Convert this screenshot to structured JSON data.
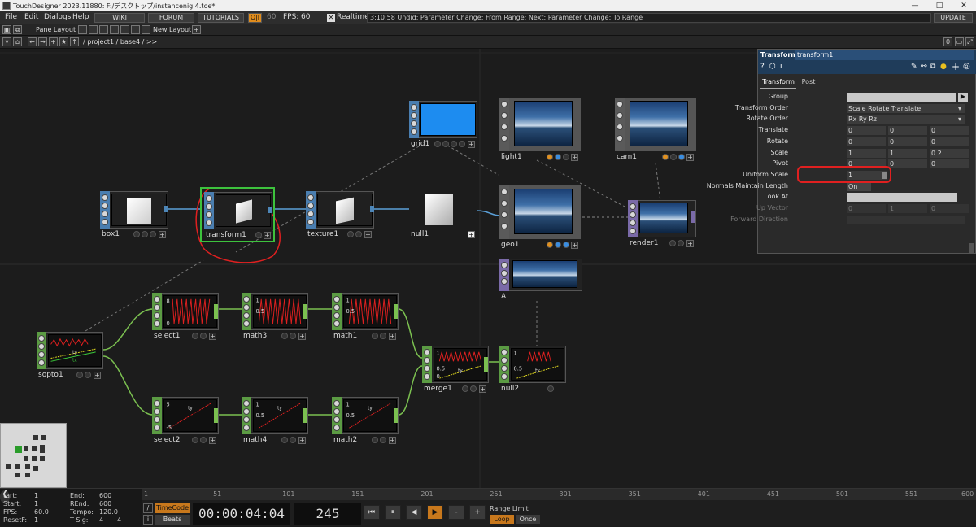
{
  "window": {
    "title": "TouchDesigner 2023.11880: F:/デスクトップ/instancenig.4.toe*",
    "minimize": "—",
    "maximize": "□",
    "close": "✕"
  },
  "menu": {
    "file": "File",
    "edit": "Edit",
    "dialogs": "Dialogs",
    "help": "Help",
    "wiki": "WIKI",
    "forum": "FORUM",
    "tutorials": "TUTORIALS",
    "oi": "O|I",
    "fps_small": "60",
    "fps_label": "FPS:",
    "fps_value": "60",
    "realtime_label": "Realtime",
    "status": "3:10:58 Undid: Parameter Change: From Range; Next: Parameter Change: To Range",
    "update": "UPDATE"
  },
  "toolbar": {
    "pane_layout": "Pane Layout",
    "new_layout": "New Layout"
  },
  "path": {
    "text": "/ project1 / base4 / >>",
    "count": "0"
  },
  "nodes": {
    "box1": "box1",
    "transform1": "transform1",
    "texture1": "texture1",
    "null1": "null1",
    "grid1": "grid1",
    "light1": "light1",
    "cam1": "cam1",
    "geo1": "geo1",
    "render1": "render1",
    "A": "A",
    "sopto1": "sopto1",
    "select1": "select1",
    "math3": "math3",
    "math1": "math1",
    "select2": "select2",
    "math4": "math4",
    "math2": "math2",
    "merge1": "merge1",
    "null2": "null2"
  },
  "chop_labels": {
    "select1_top": "8",
    "select1_bot": "0",
    "math3_top": "1",
    "math3_mid": "0.5",
    "math1_top": "1",
    "math1_mid": "0.5",
    "select2_top": "5",
    "select2_bot": "-5",
    "select2_ty": "ty",
    "math4_top": "1",
    "math4_mid": "0.5",
    "math4_ty": "ty",
    "math2_top": "1",
    "math2_mid": "0.5",
    "math2_ty": "ty",
    "merge1_top": "1",
    "merge1_mid": "0.5",
    "merge1_ty": "ty",
    "merge1_bot": "0",
    "null2_top": "1",
    "null2_mid": "0.5",
    "null2_ty": "ty",
    "sopto1_ty": "ty",
    "sopto1_tx": "tx"
  },
  "params": {
    "family": "Transform",
    "name": "transform1",
    "tab_transform": "Transform",
    "tab_post": "Post",
    "rows": [
      {
        "label": "Group",
        "v1": "",
        "v2": "",
        "v3": ""
      },
      {
        "label": "Transform Order",
        "v1": "Scale Rotate Translate",
        "v2": "",
        "v3": ""
      },
      {
        "label": "Rotate Order",
        "v1": "Rx Ry Rz",
        "v2": "",
        "v3": ""
      },
      {
        "label": "Translate",
        "v1": "0",
        "v2": "0",
        "v3": "0"
      },
      {
        "label": "Rotate",
        "v1": "0",
        "v2": "0",
        "v3": "0"
      },
      {
        "label": "Scale",
        "v1": "1",
        "v2": "1",
        "v3": "0.2"
      },
      {
        "label": "Pivot",
        "v1": "0",
        "v2": "0",
        "v3": "0"
      },
      {
        "label": "Uniform Scale",
        "v1": "1",
        "v2": "",
        "v3": ""
      },
      {
        "label": "Normals Maintain Length",
        "v1": "On",
        "v2": "",
        "v3": ""
      },
      {
        "label": "Look At",
        "v1": "",
        "v2": "",
        "v3": ""
      },
      {
        "label": "Up Vector",
        "v1": "0",
        "v2": "1",
        "v3": "0"
      },
      {
        "label": "Forward Direction",
        "v1": "",
        "v2": "",
        "v3": ""
      }
    ]
  },
  "timeline": {
    "start_label": "tart:",
    "start": "1",
    "rstart_label": "Start:",
    "rstart": "1",
    "fps_label": "FPS:",
    "fps": "60.0",
    "resetf_label": "ResetF:",
    "resetf": "1",
    "end_label": "End:",
    "end": "600",
    "rend_label": "REnd:",
    "rend": "600",
    "tempo_label": "Tempo:",
    "tempo": "120.0",
    "tsig_label": "T Sig:",
    "tsig1": "4",
    "tsig2": "4",
    "timecode": "TimeCode",
    "beats": "Beats",
    "time": "00:00:04:04",
    "frame": "245",
    "range_limit": "Range Limit",
    "loop": "Loop",
    "once": "Once",
    "ruler": [
      "1",
      "51",
      "101",
      "151",
      "201",
      "251",
      "301",
      "351",
      "401",
      "451",
      "501",
      "551",
      "600"
    ],
    "play_btns": [
      "⏮",
      "⏸",
      "◀",
      "▶",
      "-",
      "+"
    ]
  }
}
